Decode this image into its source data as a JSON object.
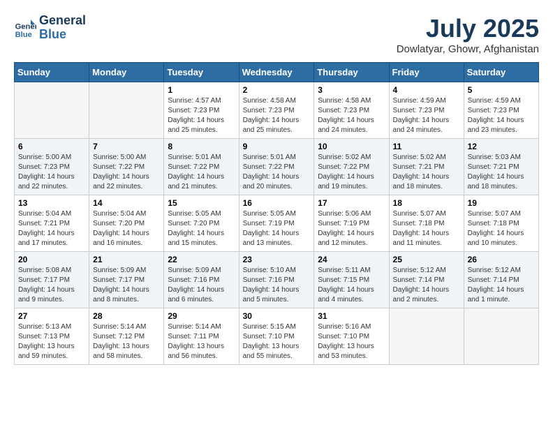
{
  "header": {
    "logo_line1": "General",
    "logo_line2": "Blue",
    "month_year": "July 2025",
    "location": "Dowlatyar, Ghowr, Afghanistan"
  },
  "weekdays": [
    "Sunday",
    "Monday",
    "Tuesday",
    "Wednesday",
    "Thursday",
    "Friday",
    "Saturday"
  ],
  "weeks": [
    [
      {
        "day": "",
        "empty": true
      },
      {
        "day": "",
        "empty": true
      },
      {
        "day": "1",
        "sunrise": "Sunrise: 4:57 AM",
        "sunset": "Sunset: 7:23 PM",
        "daylight": "Daylight: 14 hours and 25 minutes."
      },
      {
        "day": "2",
        "sunrise": "Sunrise: 4:58 AM",
        "sunset": "Sunset: 7:23 PM",
        "daylight": "Daylight: 14 hours and 25 minutes."
      },
      {
        "day": "3",
        "sunrise": "Sunrise: 4:58 AM",
        "sunset": "Sunset: 7:23 PM",
        "daylight": "Daylight: 14 hours and 24 minutes."
      },
      {
        "day": "4",
        "sunrise": "Sunrise: 4:59 AM",
        "sunset": "Sunset: 7:23 PM",
        "daylight": "Daylight: 14 hours and 24 minutes."
      },
      {
        "day": "5",
        "sunrise": "Sunrise: 4:59 AM",
        "sunset": "Sunset: 7:23 PM",
        "daylight": "Daylight: 14 hours and 23 minutes."
      }
    ],
    [
      {
        "day": "6",
        "sunrise": "Sunrise: 5:00 AM",
        "sunset": "Sunset: 7:23 PM",
        "daylight": "Daylight: 14 hours and 22 minutes."
      },
      {
        "day": "7",
        "sunrise": "Sunrise: 5:00 AM",
        "sunset": "Sunset: 7:22 PM",
        "daylight": "Daylight: 14 hours and 22 minutes."
      },
      {
        "day": "8",
        "sunrise": "Sunrise: 5:01 AM",
        "sunset": "Sunset: 7:22 PM",
        "daylight": "Daylight: 14 hours and 21 minutes."
      },
      {
        "day": "9",
        "sunrise": "Sunrise: 5:01 AM",
        "sunset": "Sunset: 7:22 PM",
        "daylight": "Daylight: 14 hours and 20 minutes."
      },
      {
        "day": "10",
        "sunrise": "Sunrise: 5:02 AM",
        "sunset": "Sunset: 7:22 PM",
        "daylight": "Daylight: 14 hours and 19 minutes."
      },
      {
        "day": "11",
        "sunrise": "Sunrise: 5:02 AM",
        "sunset": "Sunset: 7:21 PM",
        "daylight": "Daylight: 14 hours and 18 minutes."
      },
      {
        "day": "12",
        "sunrise": "Sunrise: 5:03 AM",
        "sunset": "Sunset: 7:21 PM",
        "daylight": "Daylight: 14 hours and 18 minutes."
      }
    ],
    [
      {
        "day": "13",
        "sunrise": "Sunrise: 5:04 AM",
        "sunset": "Sunset: 7:21 PM",
        "daylight": "Daylight: 14 hours and 17 minutes."
      },
      {
        "day": "14",
        "sunrise": "Sunrise: 5:04 AM",
        "sunset": "Sunset: 7:20 PM",
        "daylight": "Daylight: 14 hours and 16 minutes."
      },
      {
        "day": "15",
        "sunrise": "Sunrise: 5:05 AM",
        "sunset": "Sunset: 7:20 PM",
        "daylight": "Daylight: 14 hours and 15 minutes."
      },
      {
        "day": "16",
        "sunrise": "Sunrise: 5:05 AM",
        "sunset": "Sunset: 7:19 PM",
        "daylight": "Daylight: 14 hours and 13 minutes."
      },
      {
        "day": "17",
        "sunrise": "Sunrise: 5:06 AM",
        "sunset": "Sunset: 7:19 PM",
        "daylight": "Daylight: 14 hours and 12 minutes."
      },
      {
        "day": "18",
        "sunrise": "Sunrise: 5:07 AM",
        "sunset": "Sunset: 7:18 PM",
        "daylight": "Daylight: 14 hours and 11 minutes."
      },
      {
        "day": "19",
        "sunrise": "Sunrise: 5:07 AM",
        "sunset": "Sunset: 7:18 PM",
        "daylight": "Daylight: 14 hours and 10 minutes."
      }
    ],
    [
      {
        "day": "20",
        "sunrise": "Sunrise: 5:08 AM",
        "sunset": "Sunset: 7:17 PM",
        "daylight": "Daylight: 14 hours and 9 minutes."
      },
      {
        "day": "21",
        "sunrise": "Sunrise: 5:09 AM",
        "sunset": "Sunset: 7:17 PM",
        "daylight": "Daylight: 14 hours and 8 minutes."
      },
      {
        "day": "22",
        "sunrise": "Sunrise: 5:09 AM",
        "sunset": "Sunset: 7:16 PM",
        "daylight": "Daylight: 14 hours and 6 minutes."
      },
      {
        "day": "23",
        "sunrise": "Sunrise: 5:10 AM",
        "sunset": "Sunset: 7:16 PM",
        "daylight": "Daylight: 14 hours and 5 minutes."
      },
      {
        "day": "24",
        "sunrise": "Sunrise: 5:11 AM",
        "sunset": "Sunset: 7:15 PM",
        "daylight": "Daylight: 14 hours and 4 minutes."
      },
      {
        "day": "25",
        "sunrise": "Sunrise: 5:12 AM",
        "sunset": "Sunset: 7:14 PM",
        "daylight": "Daylight: 14 hours and 2 minutes."
      },
      {
        "day": "26",
        "sunrise": "Sunrise: 5:12 AM",
        "sunset": "Sunset: 7:14 PM",
        "daylight": "Daylight: 14 hours and 1 minute."
      }
    ],
    [
      {
        "day": "27",
        "sunrise": "Sunrise: 5:13 AM",
        "sunset": "Sunset: 7:13 PM",
        "daylight": "Daylight: 13 hours and 59 minutes."
      },
      {
        "day": "28",
        "sunrise": "Sunrise: 5:14 AM",
        "sunset": "Sunset: 7:12 PM",
        "daylight": "Daylight: 13 hours and 58 minutes."
      },
      {
        "day": "29",
        "sunrise": "Sunrise: 5:14 AM",
        "sunset": "Sunset: 7:11 PM",
        "daylight": "Daylight: 13 hours and 56 minutes."
      },
      {
        "day": "30",
        "sunrise": "Sunrise: 5:15 AM",
        "sunset": "Sunset: 7:10 PM",
        "daylight": "Daylight: 13 hours and 55 minutes."
      },
      {
        "day": "31",
        "sunrise": "Sunrise: 5:16 AM",
        "sunset": "Sunset: 7:10 PM",
        "daylight": "Daylight: 13 hours and 53 minutes."
      },
      {
        "day": "",
        "empty": true
      },
      {
        "day": "",
        "empty": true
      }
    ]
  ]
}
